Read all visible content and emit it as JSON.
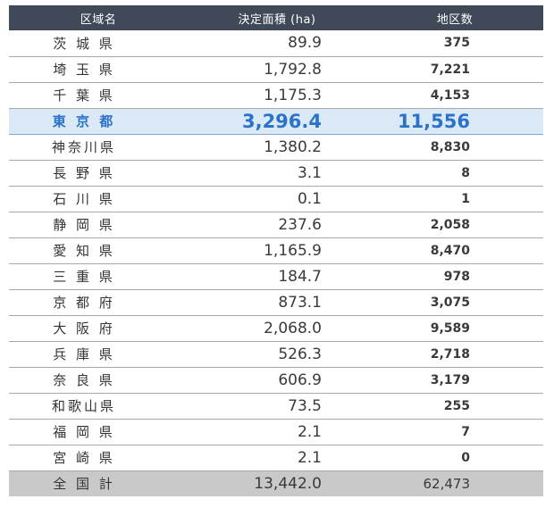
{
  "table": {
    "headers": {
      "region": "区域名",
      "area": "決定面積 (ha)",
      "districts": "地区数"
    },
    "rows": [
      {
        "name": "茨 城 県",
        "area": "89.9",
        "districts": "375"
      },
      {
        "name": "埼 玉 県",
        "area": "1,792.8",
        "districts": "7,221"
      },
      {
        "name": "千 葉 県",
        "area": "1,175.3",
        "districts": "4,153"
      },
      {
        "name": "東 京 都",
        "area": "3,296.4",
        "districts": "11,556"
      },
      {
        "name": "神奈川県",
        "area": "1,380.2",
        "districts": "8,830"
      },
      {
        "name": "長 野 県",
        "area": "3.1",
        "districts": "8"
      },
      {
        "name": "石 川 県",
        "area": "0.1",
        "districts": "1"
      },
      {
        "name": "静 岡 県",
        "area": "237.6",
        "districts": "2,058"
      },
      {
        "name": "愛 知 県",
        "area": "1,165.9",
        "districts": "8,470"
      },
      {
        "name": "三 重 県",
        "area": "184.7",
        "districts": "978"
      },
      {
        "name": "京 都 府",
        "area": "873.1",
        "districts": "3,075"
      },
      {
        "name": "大 阪 府",
        "area": "2,068.0",
        "districts": "9,589"
      },
      {
        "name": "兵 庫 県",
        "area": "526.3",
        "districts": "2,718"
      },
      {
        "name": "奈 良 県",
        "area": "606.9",
        "districts": "3,179"
      },
      {
        "name": "和歌山県",
        "area": "73.5",
        "districts": "255"
      },
      {
        "name": "福 岡 県",
        "area": "2.1",
        "districts": "7"
      },
      {
        "name": "宮 崎 県",
        "area": "2.1",
        "districts": "0"
      }
    ],
    "total": {
      "name": "全 国 計",
      "area": "13,442.0",
      "districts": "62,473"
    }
  },
  "colors": {
    "header_bg": "#3f4958",
    "highlight_bg": "#dbe9f7",
    "highlight_text": "#2b73c8",
    "total_bg": "#c9c9c9"
  }
}
